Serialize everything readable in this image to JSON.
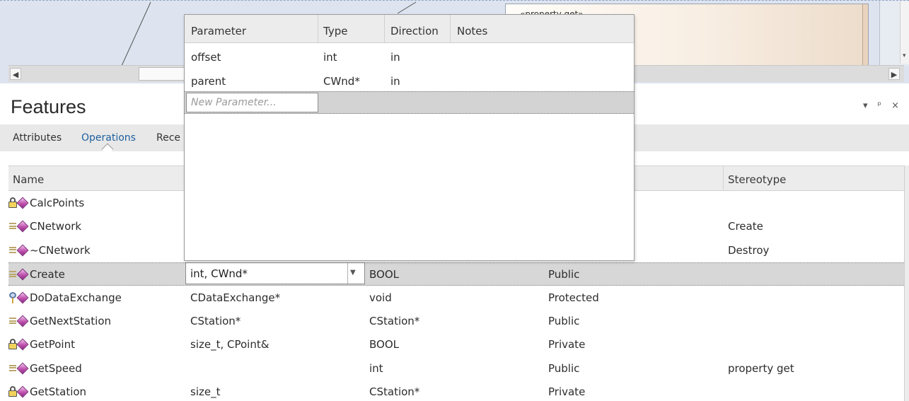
{
  "diagram": {
    "element_text": "«property get»"
  },
  "features": {
    "title": "Features",
    "controls": {
      "dropdown_glyph": "▾",
      "pin_glyph": "ᵖ",
      "close_glyph": "×"
    }
  },
  "tabs": [
    {
      "label": "Attributes",
      "active": false
    },
    {
      "label": "Operations",
      "active": true
    },
    {
      "label": "Rece",
      "active": false
    }
  ],
  "grid": {
    "columns": {
      "name": "Name",
      "stereotype": "Stereotype"
    },
    "rows": [
      {
        "icon": "lock-icon",
        "name": "CalcPoints",
        "params": "",
        "ret": "",
        "scope": "",
        "stereotype": ""
      },
      {
        "icon": "public-icon",
        "name": "CNetwork",
        "params": "",
        "ret": "",
        "scope": "",
        "stereotype": "Create"
      },
      {
        "icon": "public-icon",
        "name": "~CNetwork",
        "params": "",
        "ret": "",
        "scope": "",
        "stereotype": "Destroy"
      },
      {
        "icon": "public-icon",
        "name": "Create",
        "params": "int, CWnd*",
        "ret": "BOOL",
        "scope": "Public",
        "stereotype": ""
      },
      {
        "icon": "key-icon",
        "name": "DoDataExchange",
        "params": "CDataExchange*",
        "ret": "void",
        "scope": "Protected",
        "stereotype": ""
      },
      {
        "icon": "public-icon",
        "name": "GetNextStation",
        "params": "CStation*",
        "ret": "CStation*",
        "scope": "Public",
        "stereotype": ""
      },
      {
        "icon": "lock-icon",
        "name": "GetPoint",
        "params": "size_t, CPoint&",
        "ret": "BOOL",
        "scope": "Private",
        "stereotype": ""
      },
      {
        "icon": "public-icon",
        "name": "GetSpeed",
        "params": "",
        "ret": "int",
        "scope": "Public",
        "stereotype": "property get"
      },
      {
        "icon": "lock-icon",
        "name": "GetStation",
        "params": "size_t",
        "ret": "CStation*",
        "scope": "Private",
        "stereotype": ""
      }
    ],
    "selected_row": 3
  },
  "param_popup": {
    "columns": [
      "Parameter",
      "Type",
      "Direction",
      "Notes"
    ],
    "rows": [
      {
        "name": "offset",
        "type": "int",
        "direction": "in"
      },
      {
        "name": "parent",
        "type": "CWnd*",
        "direction": "in"
      }
    ],
    "new_placeholder": "New Parameter..."
  },
  "colors": {
    "accent": "#1d5f9e",
    "selected_row": "#d7d7d7",
    "diagram_bg": "#dde4ef",
    "operation_icon": "#c052ae"
  }
}
